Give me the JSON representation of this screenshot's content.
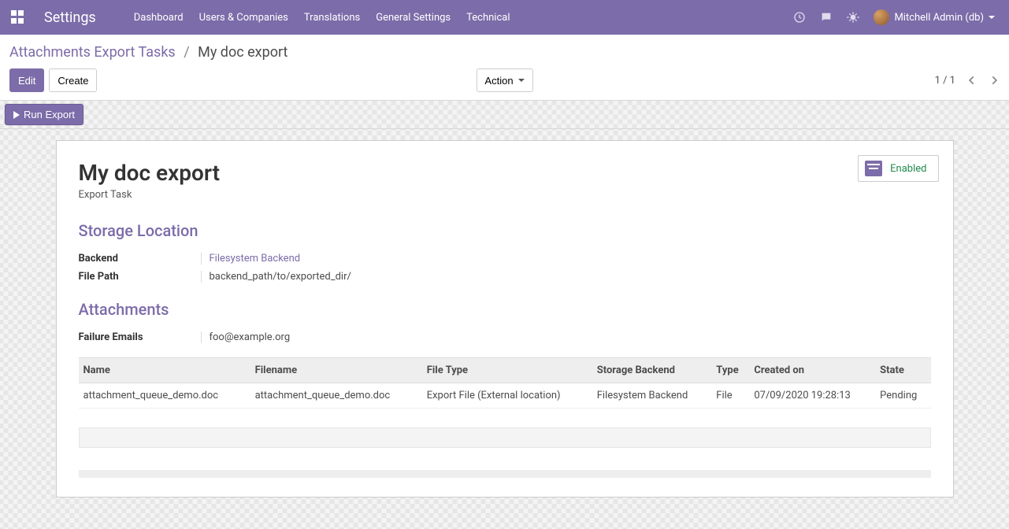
{
  "navbar": {
    "brand": "Settings",
    "links": [
      "Dashboard",
      "Users & Companies",
      "Translations",
      "General Settings",
      "Technical"
    ],
    "user": "Mitchell Admin (db)"
  },
  "breadcrumb": {
    "parent": "Attachments Export Tasks",
    "current": "My doc export"
  },
  "buttons": {
    "edit": "Edit",
    "create": "Create",
    "action": "Action",
    "run_export": "Run Export"
  },
  "pager": "1 / 1",
  "status": "Enabled",
  "record": {
    "title": "My doc export",
    "subtitle": "Export Task"
  },
  "sections": {
    "storage": "Storage Location",
    "attachments": "Attachments"
  },
  "fields": {
    "backend_label": "Backend",
    "backend_value": "Filesystem Backend",
    "filepath_label": "File Path",
    "filepath_value": "backend_path/to/exported_dir/",
    "failure_emails_label": "Failure Emails",
    "failure_emails_value": "foo@example.org"
  },
  "table": {
    "headers": [
      "Name",
      "Filename",
      "File Type",
      "Storage Backend",
      "Type",
      "Created on",
      "State"
    ],
    "rows": [
      {
        "name": "attachment_queue_demo.doc",
        "filename": "attachment_queue_demo.doc",
        "file_type": "Export File (External location)",
        "backend": "Filesystem Backend",
        "type": "File",
        "created": "07/09/2020 19:28:13",
        "state": "Pending"
      }
    ]
  }
}
